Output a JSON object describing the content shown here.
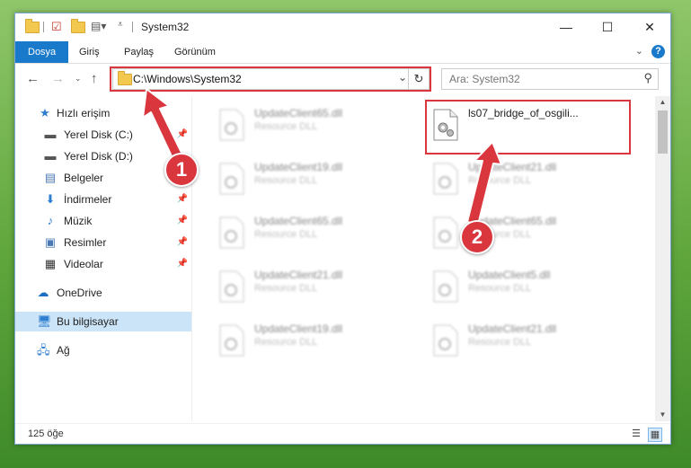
{
  "window": {
    "title": "System32",
    "controls": {
      "minimize": "—",
      "maximize": "☐",
      "close": "✕"
    }
  },
  "ribbon": {
    "tabs": [
      {
        "label": "Dosya",
        "active": true
      },
      {
        "label": "Giriş"
      },
      {
        "label": "Paylaş"
      },
      {
        "label": "Görünüm"
      }
    ],
    "help": "?"
  },
  "address": {
    "path": "C:\\Windows\\System32",
    "refresh": "↻"
  },
  "search": {
    "placeholder": "Ara: System32"
  },
  "nav": {
    "items": [
      {
        "label": "Hızlı erişim",
        "icon": "star-icon"
      },
      {
        "label": "Yerel Disk (C:)",
        "icon": "drive-icon",
        "pinned": true
      },
      {
        "label": "Yerel Disk (D:)",
        "icon": "drive-icon"
      },
      {
        "label": "Belgeler",
        "icon": "documents-icon"
      },
      {
        "label": "İndirmeler",
        "icon": "downloads-icon",
        "pinned": true
      },
      {
        "label": "Müzik",
        "icon": "music-icon",
        "pinned": true
      },
      {
        "label": "Resimler",
        "icon": "pictures-icon",
        "pinned": true
      },
      {
        "label": "Videolar",
        "icon": "videos-icon",
        "pinned": true
      },
      {
        "label": "OneDrive",
        "icon": "cloud-icon"
      },
      {
        "label": "Bu bilgisayar",
        "icon": "computer-icon",
        "selected": true
      },
      {
        "label": "Ağ",
        "icon": "network-icon"
      }
    ]
  },
  "files": [
    {
      "name": "UpdateClient65.dll",
      "type": "Resource DLL",
      "blurred": true
    },
    {
      "name": "ls07_bridge_of_osgili...",
      "type": "",
      "blurred": false
    },
    {
      "name": "UpdateClient19.dll",
      "type": "Resource DLL",
      "blurred": true
    },
    {
      "name": "UpdateClient21.dll",
      "type": "Resource DLL",
      "blurred": true
    },
    {
      "name": "UpdateClient65.dll",
      "type": "Resource DLL",
      "blurred": true
    },
    {
      "name": "UpdateClient65.dll",
      "type": "Resource DLL",
      "blurred": true
    },
    {
      "name": "UpdateClient21.dll",
      "type": "Resource DLL",
      "blurred": true
    },
    {
      "name": "UpdateClient5.dll",
      "type": "Resource DLL",
      "blurred": true
    },
    {
      "name": "UpdateClient19.dll",
      "type": "Resource DLL",
      "blurred": true
    },
    {
      "name": "UpdateClient21.dll",
      "type": "Resource DLL",
      "blurred": true
    }
  ],
  "status": {
    "count": "125 öğe"
  },
  "annotations": {
    "step1": "1",
    "step2": "2",
    "color": "#d9363e"
  }
}
